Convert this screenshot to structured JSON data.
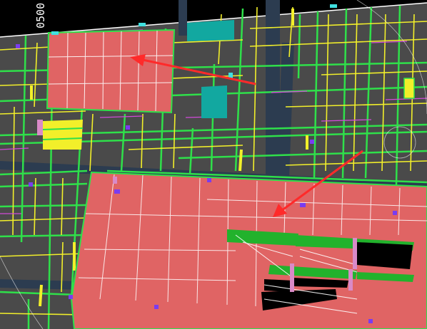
{
  "coordinate_label": "0500",
  "palette": {
    "background": "#000000",
    "ground": "#4a4a4a",
    "wall_green": "#2fe04a",
    "line_yellow": "#f2ef2a",
    "line_magenta": "#d14bd8",
    "zone_salmon": "#e06464",
    "zone_cyan": "#12a8a0",
    "zone_yellow": "#f2ef2a",
    "band_green": "#22b22c",
    "road_blue": "#2c3c50",
    "arrow_red": "#ff2a2a",
    "grid_white": "#ffffff"
  }
}
